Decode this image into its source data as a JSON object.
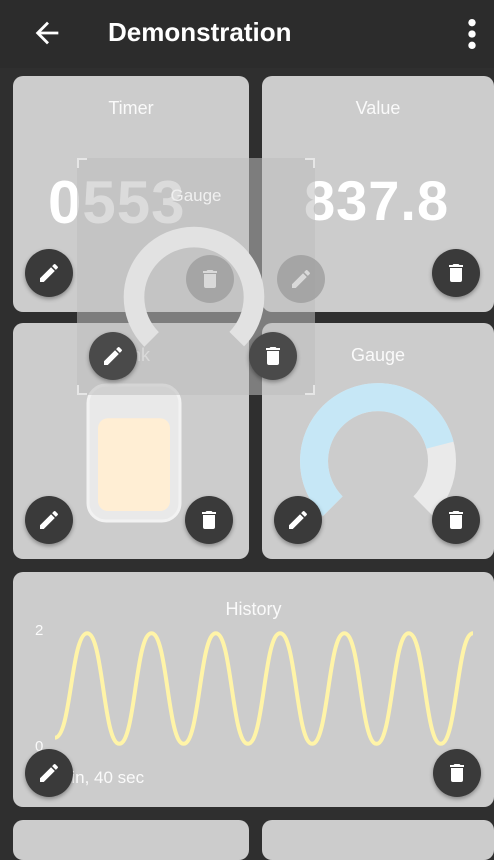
{
  "appbar": {
    "title": "Demonstration",
    "back_icon": "arrow-left-icon",
    "menu_icon": "more-vert-icon"
  },
  "cards": {
    "timer": {
      "title": "Timer",
      "value": "0553",
      "edit_icon": "pencil-icon",
      "delete_icon": "trash-icon"
    },
    "value": {
      "title": "Value",
      "value": "837.8"
    },
    "tank": {
      "title": "Tank",
      "fill_level": 0.8,
      "fill_color": "#ffeed4"
    },
    "gauge": {
      "title": "Gauge",
      "level": 0.78,
      "arc_color": "#c6e7f6",
      "track_color": "#eaeaea"
    },
    "history": {
      "title": "History",
      "y_max_label": "2",
      "y_min_label": "0",
      "duration": "1 min, 40 sec",
      "line_color": "#fff4a8"
    }
  },
  "dragging": {
    "title": "Gauge"
  },
  "chart_data": {
    "type": "line",
    "title": "History",
    "ylim": [
      0,
      2
    ],
    "series": [
      {
        "values": [
          0.2,
          1.9,
          0.1,
          1.9,
          0.1,
          1.9,
          0.1,
          1.9,
          0.1,
          1.9,
          0.1,
          1.9,
          0.1,
          1.9
        ]
      }
    ]
  }
}
